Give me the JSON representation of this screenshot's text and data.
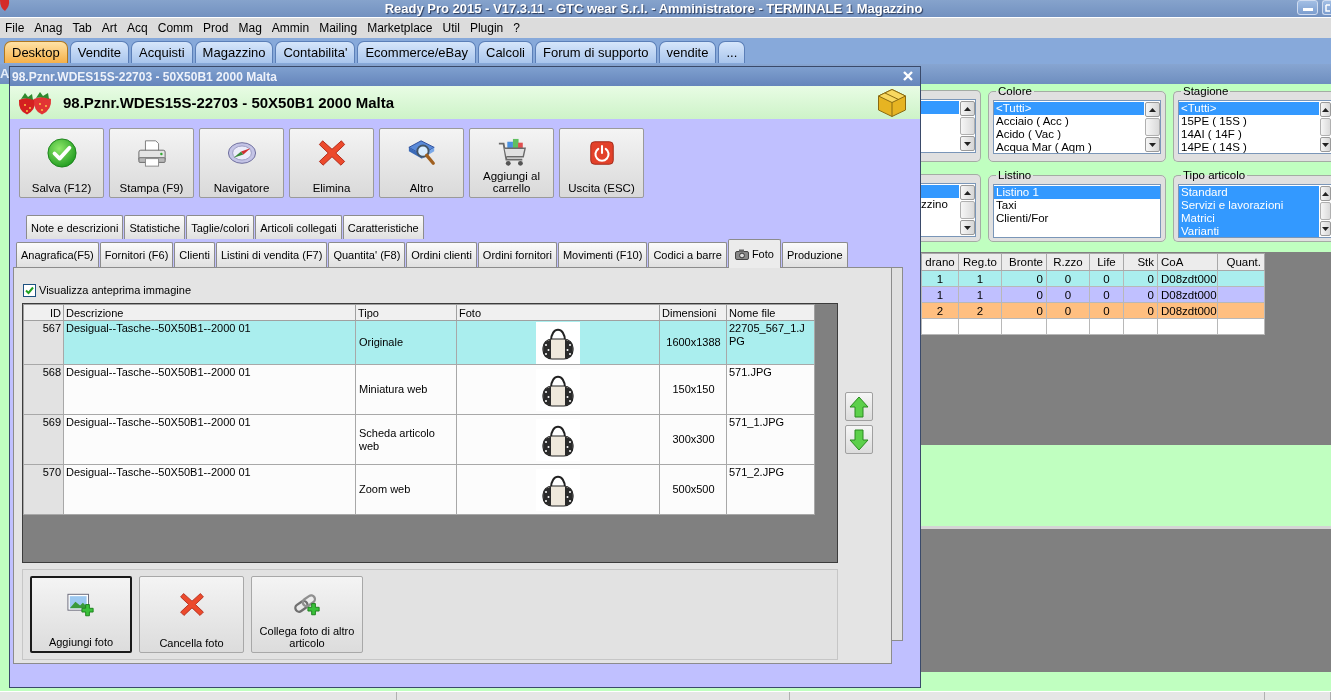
{
  "window": {
    "title": "Ready Pro 2015 - V17.3.11 - GTC wear S.r.l. - Amministratore - TERMINALE 1 Magazzino"
  },
  "menu": [
    "File",
    "Anag",
    "Tab",
    "Art",
    "Acq",
    "Comm",
    "Prod",
    "Mag",
    "Ammin",
    "Mailing",
    "Marketplace",
    "Util",
    "Plugin",
    "?"
  ],
  "tabs": [
    {
      "label": "Desktop",
      "selected": true
    },
    {
      "label": "Vendite",
      "selected": false
    },
    {
      "label": "Acquisti",
      "selected": false
    },
    {
      "label": "Magazzino",
      "selected": false
    },
    {
      "label": "Contabilita'",
      "selected": false
    },
    {
      "label": "Ecommerce/eBay",
      "selected": false
    },
    {
      "label": "Calcoli",
      "selected": false
    },
    {
      "label": "Forum di supporto",
      "selected": false
    },
    {
      "label": "vendite",
      "selected": false
    },
    {
      "label": "...",
      "selected": false
    }
  ],
  "background_window": {
    "title": "A",
    "filters": [
      {
        "items": [
          {
            "selected": true
          }
        ],
        "scrollbar": true
      },
      {
        "label": "Colore",
        "items": [
          {
            "text": "<Tutti>",
            "selected": true
          },
          {
            "text": "Acciaio ( Acc )",
            "selected": false
          },
          {
            "text": "Acido ( Vac )",
            "selected": false
          },
          {
            "text": "Acqua Mar ( Aqm )",
            "selected": false
          }
        ],
        "scrollbar": true
      },
      {
        "label": "Stagione",
        "items": [
          {
            "text": "<Tutti>",
            "selected": true
          },
          {
            "text": "15PE ( 15S )",
            "selected": false
          },
          {
            "text": "14AI ( 14F )",
            "selected": false
          },
          {
            "text": "14PE ( 14S )",
            "selected": false
          }
        ],
        "scrollbar": true
      },
      {
        "items": [
          {
            "selected": true
          },
          {
            "text": "zzino",
            "selected": false
          }
        ],
        "scrollbar": true
      },
      {
        "label": "Listino",
        "items": [
          {
            "text": "Listino 1",
            "selected": true
          },
          {
            "text": "Taxi",
            "selected": false
          },
          {
            "text": "Clienti/For",
            "selected": false
          }
        ],
        "scrollbar": false
      },
      {
        "label": "Tipo articolo",
        "items": [
          {
            "text": "Standard",
            "selected": true
          },
          {
            "text": "Servizi e lavorazioni",
            "selected": true
          },
          {
            "text": "Matrici",
            "selected": true
          },
          {
            "text": "Varianti",
            "selected": true
          }
        ],
        "scrollbar": true
      }
    ],
    "table": {
      "columns": [
        "drano",
        "Reg.to",
        "Bronte",
        "R.zzo",
        "Life",
        "Stk",
        "CoA",
        "Quant."
      ],
      "rows": [
        {
          "color": "#aaeeee",
          "cells": [
            "1",
            "1",
            "0",
            "0",
            "0",
            "0",
            "D08zdt000"
          ]
        },
        {
          "color": "#c0c0ff",
          "cells": [
            "1",
            "1",
            "0",
            "0",
            "0",
            "0",
            "D08zdt000"
          ]
        },
        {
          "color": "#ffbf80",
          "cells": [
            "2",
            "2",
            "0",
            "0",
            "0",
            "0",
            "D08zdt000"
          ]
        }
      ]
    }
  },
  "dialog": {
    "title": "98.Pznr.WDES15S-22703 - 50X50B1 2000 Malta",
    "heading": "98.Pznr.WDES15S-22703 - 50X50B1 2000 Malta",
    "toolbar": [
      {
        "kind": "save",
        "label": "Salva (F12)"
      },
      {
        "kind": "print",
        "label": "Stampa (F9)"
      },
      {
        "kind": "navigator",
        "label": "Navigatore"
      },
      {
        "kind": "delete",
        "label": "Elimina"
      },
      {
        "kind": "other",
        "label": "Altro"
      },
      {
        "kind": "cart",
        "label": "Aggiungi al carrello"
      },
      {
        "kind": "exit",
        "label": "Uscita (ESC)"
      }
    ],
    "tab_rows": [
      {
        "tabs": [
          {
            "label": "Note e descrizioni",
            "selected": false,
            "kind": "text"
          },
          {
            "label": "Statistiche",
            "selected": false,
            "kind": "text"
          },
          {
            "label": "Taglie/colori",
            "selected": false,
            "kind": "text"
          },
          {
            "label": "Articoli collegati",
            "selected": false,
            "kind": "text"
          },
          {
            "label": "Caratteristiche",
            "selected": false,
            "kind": "text"
          }
        ]
      },
      {
        "tabs": [
          {
            "label": "Anagrafica(F5)",
            "selected": false,
            "kind": "text"
          },
          {
            "label": "Fornitori (F6)",
            "selected": false,
            "kind": "text"
          },
          {
            "label": "Clienti",
            "selected": false,
            "kind": "text"
          },
          {
            "label": "Listini di vendita (F7)",
            "selected": false,
            "kind": "text"
          },
          {
            "label": "Quantita' (F8)",
            "selected": false,
            "kind": "text"
          },
          {
            "label": "Ordini clienti",
            "selected": false,
            "kind": "text"
          },
          {
            "label": "Ordini fornitori",
            "selected": false,
            "kind": "text"
          },
          {
            "label": "Movimenti (F10)",
            "selected": false,
            "kind": "text"
          },
          {
            "label": "Codici a barre",
            "selected": false,
            "kind": "text"
          },
          {
            "label": "Foto",
            "selected": true,
            "kind": "photo"
          },
          {
            "label": "Produzione",
            "selected": false,
            "kind": "text"
          }
        ]
      }
    ],
    "preview_checkbox": {
      "label": "Visualizza anteprima immagine",
      "checked": true
    },
    "photo_table": {
      "columns": [
        "ID",
        "Descrizione",
        "Tipo",
        "Foto",
        "Dimensioni",
        "Nome file"
      ],
      "rows": [
        {
          "id": "567",
          "description": "Desigual--Tasche--50X50B1--2000 01",
          "type": "Originale",
          "dimensions": "1600x1388",
          "file_name": "22705_567_1.JPG",
          "selected": true
        },
        {
          "id": "568",
          "description": "Desigual--Tasche--50X50B1--2000 01",
          "type": "Miniatura web",
          "dimensions": "150x150",
          "file_name": "571.JPG",
          "selected": false
        },
        {
          "id": "569",
          "description": "Desigual--Tasche--50X50B1--2000 01",
          "type": "Scheda articolo web",
          "dimensions": "300x300",
          "file_name": "571_1.JPG",
          "selected": false
        },
        {
          "id": "570",
          "description": "Desigual--Tasche--50X50B1--2000 01",
          "type": "Zoom web",
          "dimensions": "500x500",
          "file_name": "571_2.JPG",
          "selected": false
        }
      ]
    },
    "photo_buttons": [
      {
        "kind": "add",
        "label": "Aggiungi foto",
        "focused": true
      },
      {
        "kind": "delete",
        "label": "Cancella foto",
        "focused": false
      },
      {
        "kind": "link",
        "label": "Collega foto di altro articolo",
        "focused": false
      }
    ]
  }
}
